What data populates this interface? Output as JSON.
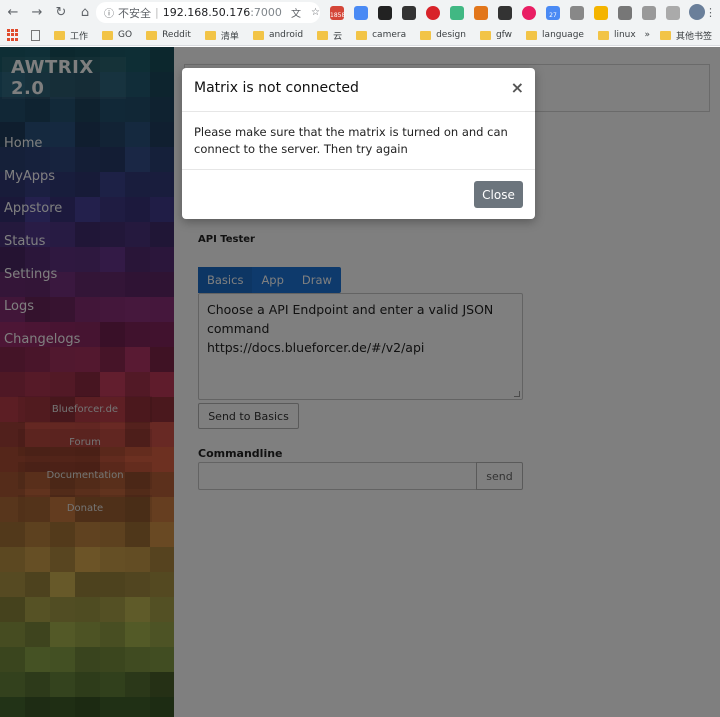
{
  "browser": {
    "security_label": "不安全",
    "host": "192.168.50.176",
    "port": ":7000",
    "bookmarks": [
      "工作",
      "GO",
      "Reddit",
      "清单",
      "android",
      "云",
      "camera",
      "design",
      "gfw",
      "language",
      "linux"
    ],
    "overflow": "»",
    "other_bookmarks": "其他书签",
    "badge_count": "1858",
    "calendar_day": "27"
  },
  "sidebar": {
    "title": "AWTRIX 2.0",
    "items": [
      {
        "label": "Home"
      },
      {
        "label": "MyApps"
      },
      {
        "label": "Appstore"
      },
      {
        "label": "Status"
      },
      {
        "label": "Settings"
      },
      {
        "label": "Logs"
      },
      {
        "label": "Changelogs"
      }
    ],
    "links": [
      {
        "label": "Blueforcer.de"
      },
      {
        "label": "Forum"
      },
      {
        "label": "Documentation"
      },
      {
        "label": "Donate"
      }
    ]
  },
  "api_tester": {
    "title": "API Tester",
    "tabs": [
      "Basics",
      "App",
      "Draw"
    ],
    "text_line1": "Choose a API Endpoint and enter a valid JSON",
    "text_line2": "command",
    "text_line3": "https://docs.blueforcer.de/#/v2/api",
    "send_button": "Send to Basics"
  },
  "commandline": {
    "title": "Commandline",
    "input_value": "",
    "send_button": "send"
  },
  "modal": {
    "title": "Matrix is not connected",
    "close": "×",
    "body": "Please make sure that the matrix is turned on and can connect to the server. Then try again",
    "button": "Close"
  }
}
